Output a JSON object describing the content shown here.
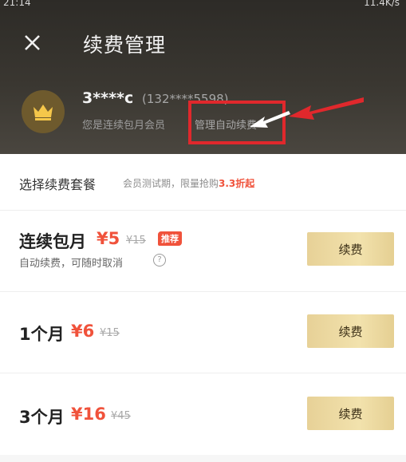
{
  "status_bar": {
    "time": "21:14",
    "right": "11.4K/s"
  },
  "header": {
    "title": "续费管理"
  },
  "user": {
    "name": "3****c",
    "phone": "(132****5598)",
    "status_text": "您是连续包月会员",
    "manage_link": "管理自动续费"
  },
  "section": {
    "title": "选择续费套餐",
    "note_prefix": "会员测试期，限量抢购",
    "note_highlight": "3.3折起"
  },
  "plans": [
    {
      "name": "连续包月",
      "price": "¥5",
      "original": "¥15",
      "tag": "推荐",
      "desc": "自动续费，可随时取消",
      "button": "续费"
    },
    {
      "name": "1个月",
      "price": "¥6",
      "original": "¥15",
      "button": "续费"
    },
    {
      "name": "3个月",
      "price": "¥16",
      "original": "¥45",
      "button": "续费"
    }
  ],
  "colors": {
    "header_bg": "#2d2b27",
    "accent_red": "#f0523b",
    "button_gold": "#ebd89f",
    "annotation_red": "#e0282c"
  },
  "icons": {
    "close": "close-icon",
    "crown": "crown-icon",
    "help": "help-icon"
  }
}
